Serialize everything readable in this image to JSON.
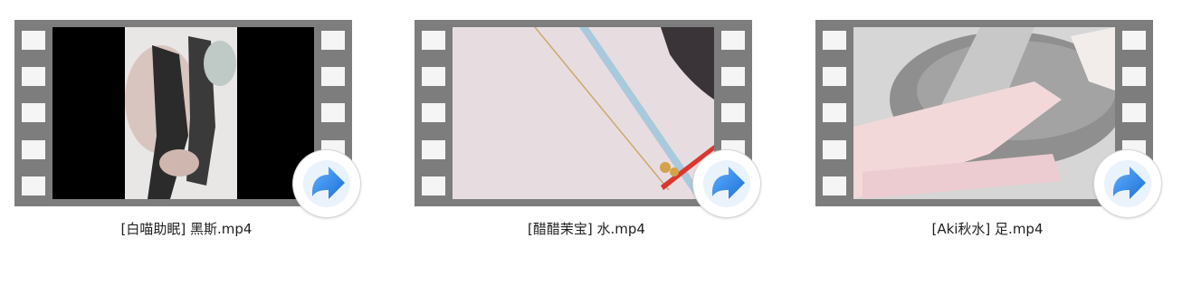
{
  "files": [
    {
      "name": "[白喵助眠] 黑斯.mp4",
      "icon": "video-thumbnail-icon",
      "overlay_icon": "share-arrow-icon"
    },
    {
      "name": "[醋醋茉宝] 水.mp4",
      "icon": "video-thumbnail-icon",
      "overlay_icon": "share-arrow-icon"
    },
    {
      "name": "[Aki秋水] 足.mp4",
      "icon": "video-thumbnail-icon",
      "overlay_icon": "share-arrow-icon"
    }
  ],
  "colors": {
    "filmstrip": "#7d7d7d",
    "share_badge_blue": "#2f86e8"
  }
}
